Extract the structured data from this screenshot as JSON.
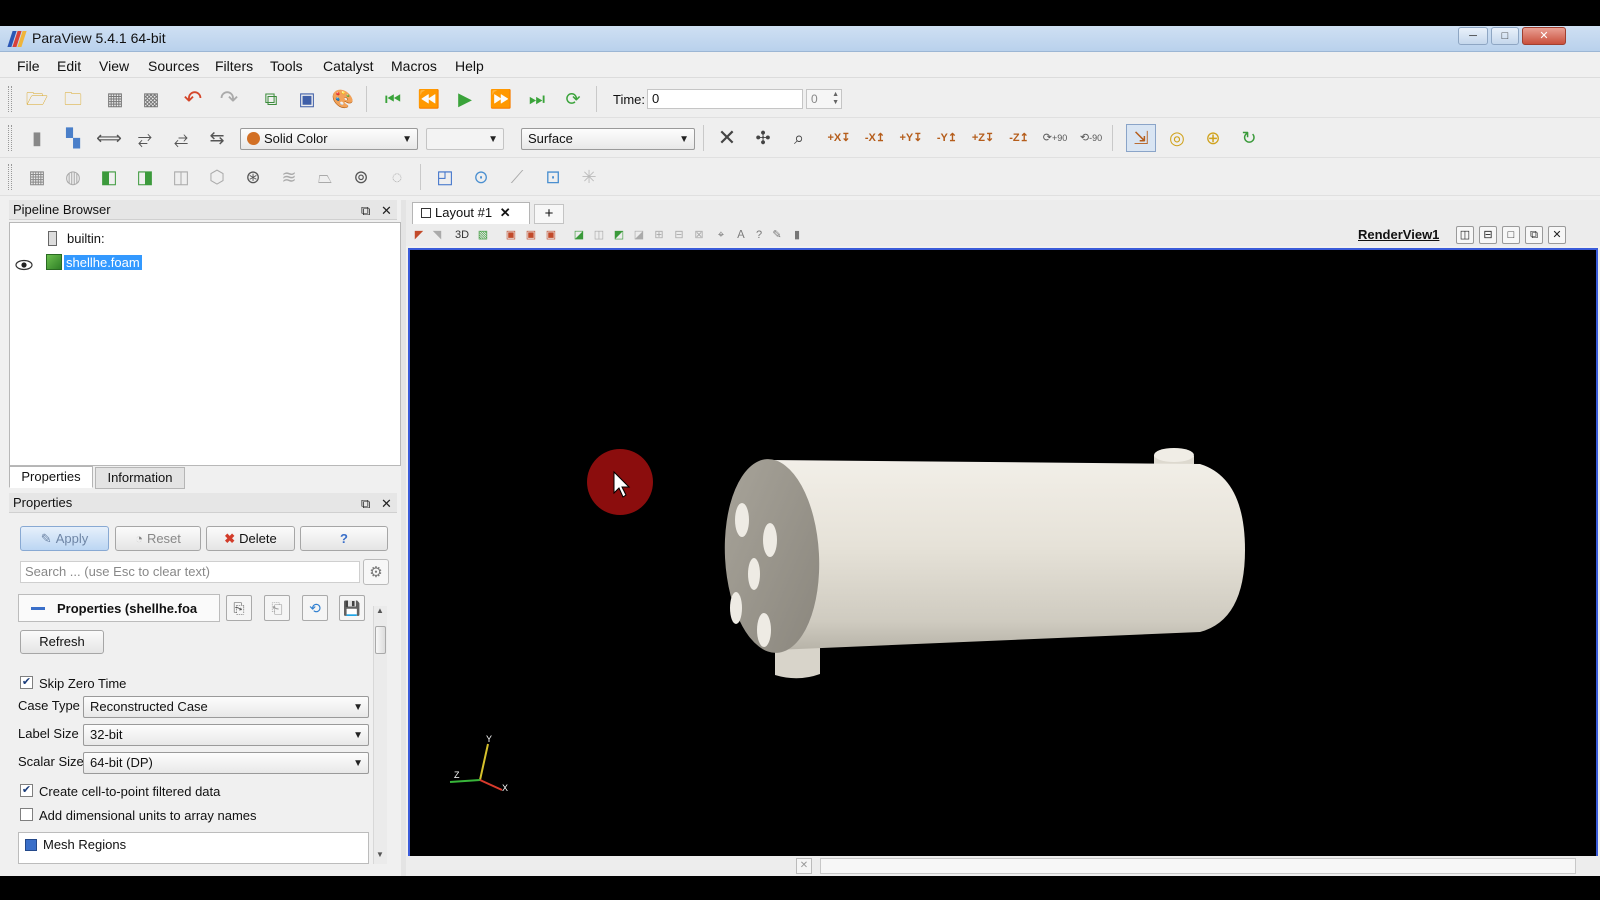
{
  "window": {
    "title": "ParaView 5.4.1 64-bit",
    "controls": {
      "minimize": "─",
      "maximize": "□",
      "close": "✕"
    }
  },
  "menu": [
    "File",
    "Edit",
    "View",
    "Sources",
    "Filters",
    "Tools",
    "Catalyst",
    "Macros",
    "Help"
  ],
  "toolbar": {
    "time_label": "Time:",
    "time_value": "0",
    "time_index": "0",
    "color_by": "Solid Color",
    "representation": "Surface",
    "camera_labels": [
      "+X",
      "-X",
      "+Y",
      "-Y",
      "+Z",
      "-Z",
      "+90",
      "-90"
    ]
  },
  "pipeline_browser": {
    "title": "Pipeline Browser",
    "items": [
      {
        "name": "builtin:"
      },
      {
        "name": "shellhe.foam"
      }
    ]
  },
  "properties_tabs": [
    "Properties",
    "Information"
  ],
  "properties_panel": {
    "title": "Properties",
    "buttons": {
      "apply": "Apply",
      "reset": "Reset",
      "delete": "Delete",
      "help": "?"
    },
    "search_placeholder": "Search ... (use Esc to clear text)",
    "section_title": "Properties (shellhe.foa",
    "refresh": "Refresh",
    "skip_zero_time": {
      "label": "Skip Zero Time",
      "checked": true
    },
    "case_type": {
      "label": "Case Type",
      "value": "Reconstructed Case"
    },
    "label_size": {
      "label": "Label Size",
      "value": "32-bit"
    },
    "scalar_size": {
      "label": "Scalar Size",
      "value": "64-bit (DP)"
    },
    "cell_to_point": {
      "label": "Create cell-to-point filtered data",
      "checked": true
    },
    "dimensional_units": {
      "label": "Add dimensional units to array names",
      "checked": false
    },
    "mesh_regions": {
      "label": "Mesh Regions"
    }
  },
  "layout": {
    "tab_label": "Layout #1",
    "add_tab": "+",
    "view_mode": "3D",
    "view_name": "RenderView1"
  },
  "axes": {
    "x": "X",
    "y": "Y",
    "z": "Z"
  },
  "colors": {
    "selection": "#3399ff",
    "render_background": "#000000",
    "active_view_border": "#3a5bd9",
    "model_surface": "#e9e5dc",
    "cursor_highlight": "#8b0d0d"
  }
}
